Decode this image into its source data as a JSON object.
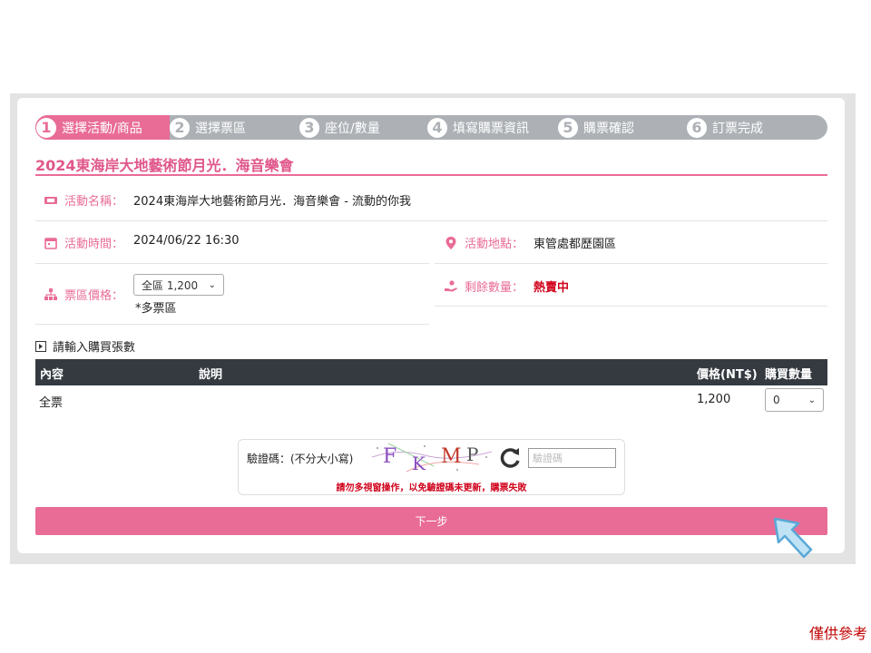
{
  "steps": [
    {
      "num": "1",
      "label": "選擇活動/商品"
    },
    {
      "num": "2",
      "label": "選擇票區"
    },
    {
      "num": "3",
      "label": "座位/數量"
    },
    {
      "num": "4",
      "label": "填寫購票資訊"
    },
    {
      "num": "5",
      "label": "購票確認"
    },
    {
      "num": "6",
      "label": "訂票完成"
    }
  ],
  "event": {
    "title": "2024東海岸大地藝術節月光．海音樂會",
    "name_label": "活動名稱：",
    "name_value": "2024東海岸大地藝術節月光．海音樂會 - 流動的你我",
    "time_label": "活動時間：",
    "time_value": "2024/06/22  16:30",
    "location_label": "活動地點：",
    "location_value": "東管處都歷園區",
    "price_label": "票區價格：",
    "price_selected": "全區 1,200",
    "price_note": "*多票區",
    "remain_label": "剩餘數量：",
    "remain_value": "熱賣中"
  },
  "quantity": {
    "section_title": "請輸入購買張數",
    "headers": {
      "content": "內容",
      "desc": "說明",
      "price": "價格(NT$)",
      "qty": "購買數量"
    },
    "rows": [
      {
        "content": "全票",
        "desc": "",
        "price": "1,200",
        "qty": "0"
      }
    ]
  },
  "captcha": {
    "label": "驗證碼：(不分大小寫)",
    "chars": [
      "F",
      "K",
      "M",
      "P"
    ],
    "placeholder": "驗證碼",
    "warning": "請勿多視窗操作，以免驗證碼未更新，購票失敗"
  },
  "next_label": "下一步",
  "disclaimer": "僅供參考",
  "colors": {
    "accent": "#e96c97",
    "step_gray": "#adb1b6",
    "header_dark": "#343a40",
    "alert_red": "#d0021b"
  }
}
